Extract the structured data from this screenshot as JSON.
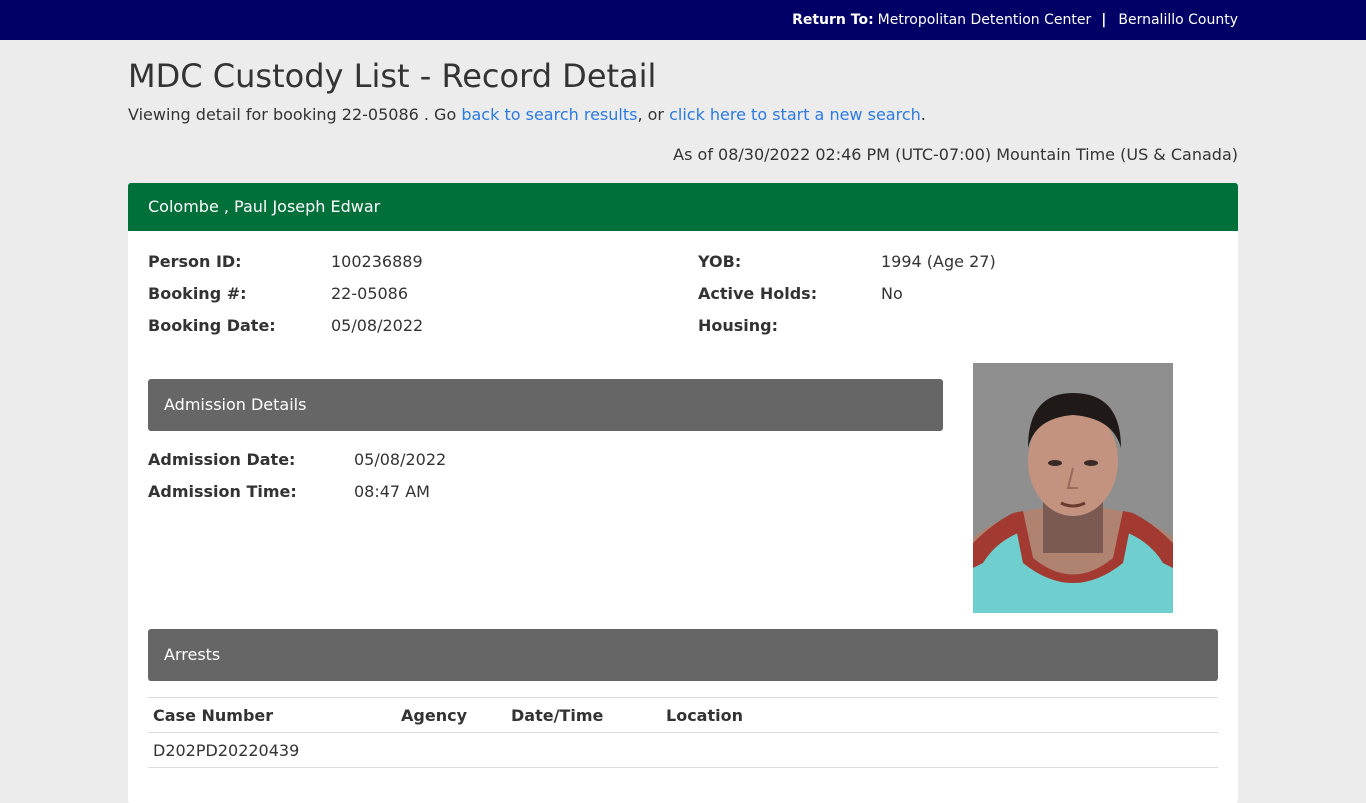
{
  "topbar": {
    "return_label": "Return To:",
    "link1": "Metropolitan Detention Center",
    "separator": "|",
    "link2": "Bernalillo County"
  },
  "page": {
    "title": "MDC Custody List - Record Detail",
    "intro_prefix": "Viewing detail for booking 22-05086 . Go",
    "back_link": "back to search results",
    "intro_mid": ", or",
    "new_search_link": "click here to start a new search",
    "intro_suffix": ".",
    "as_of": "As of 08/30/2022 02:46 PM (UTC-07:00) Mountain Time (US & Canada)"
  },
  "record": {
    "name": "Colombe , Paul Joseph Edwar",
    "person_id_label": "Person ID:",
    "person_id": "100236889",
    "booking_label": "Booking #:",
    "booking": "22-05086",
    "booking_date_label": "Booking Date:",
    "booking_date": "05/08/2022",
    "yob_label": "YOB:",
    "yob": "1994 (Age 27)",
    "holds_label": "Active Holds:",
    "holds": "No",
    "housing_label": "Housing:",
    "housing": ""
  },
  "admission": {
    "header": "Admission Details",
    "date_label": "Admission Date:",
    "date": "05/08/2022",
    "time_label": "Admission Time:",
    "time": "08:47 AM"
  },
  "arrests": {
    "header": "Arrests",
    "columns": [
      "Case Number",
      "Agency",
      "Date/Time",
      "Location"
    ],
    "rows": [
      [
        "D202PD20220439",
        "",
        "",
        ""
      ]
    ]
  },
  "colors": {
    "topbar": "#000066",
    "name_header": "#00703a",
    "panel_header": "#666666",
    "link": "#2a7ae2"
  }
}
